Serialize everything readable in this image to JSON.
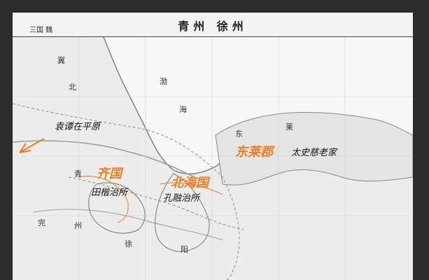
{
  "header": {
    "title": "青州  徐州",
    "corner_label": "三国 魏"
  },
  "places": [
    "冀",
    "北",
    "渤",
    "海",
    "东",
    "莱",
    "青",
    "州",
    "徐",
    "阳",
    "完"
  ],
  "annotations": {
    "yuan_tan": "袁谭在平原",
    "donglai": "东莱郡",
    "taishi": "太史慈老家",
    "qiguo": "齐国",
    "tian_kai": "田楷治所",
    "beihai": "北海国",
    "kong_rong": "孔融治所"
  },
  "colors": {
    "annotation_accent": "#ef7d22",
    "annotation_dark": "#111111"
  }
}
